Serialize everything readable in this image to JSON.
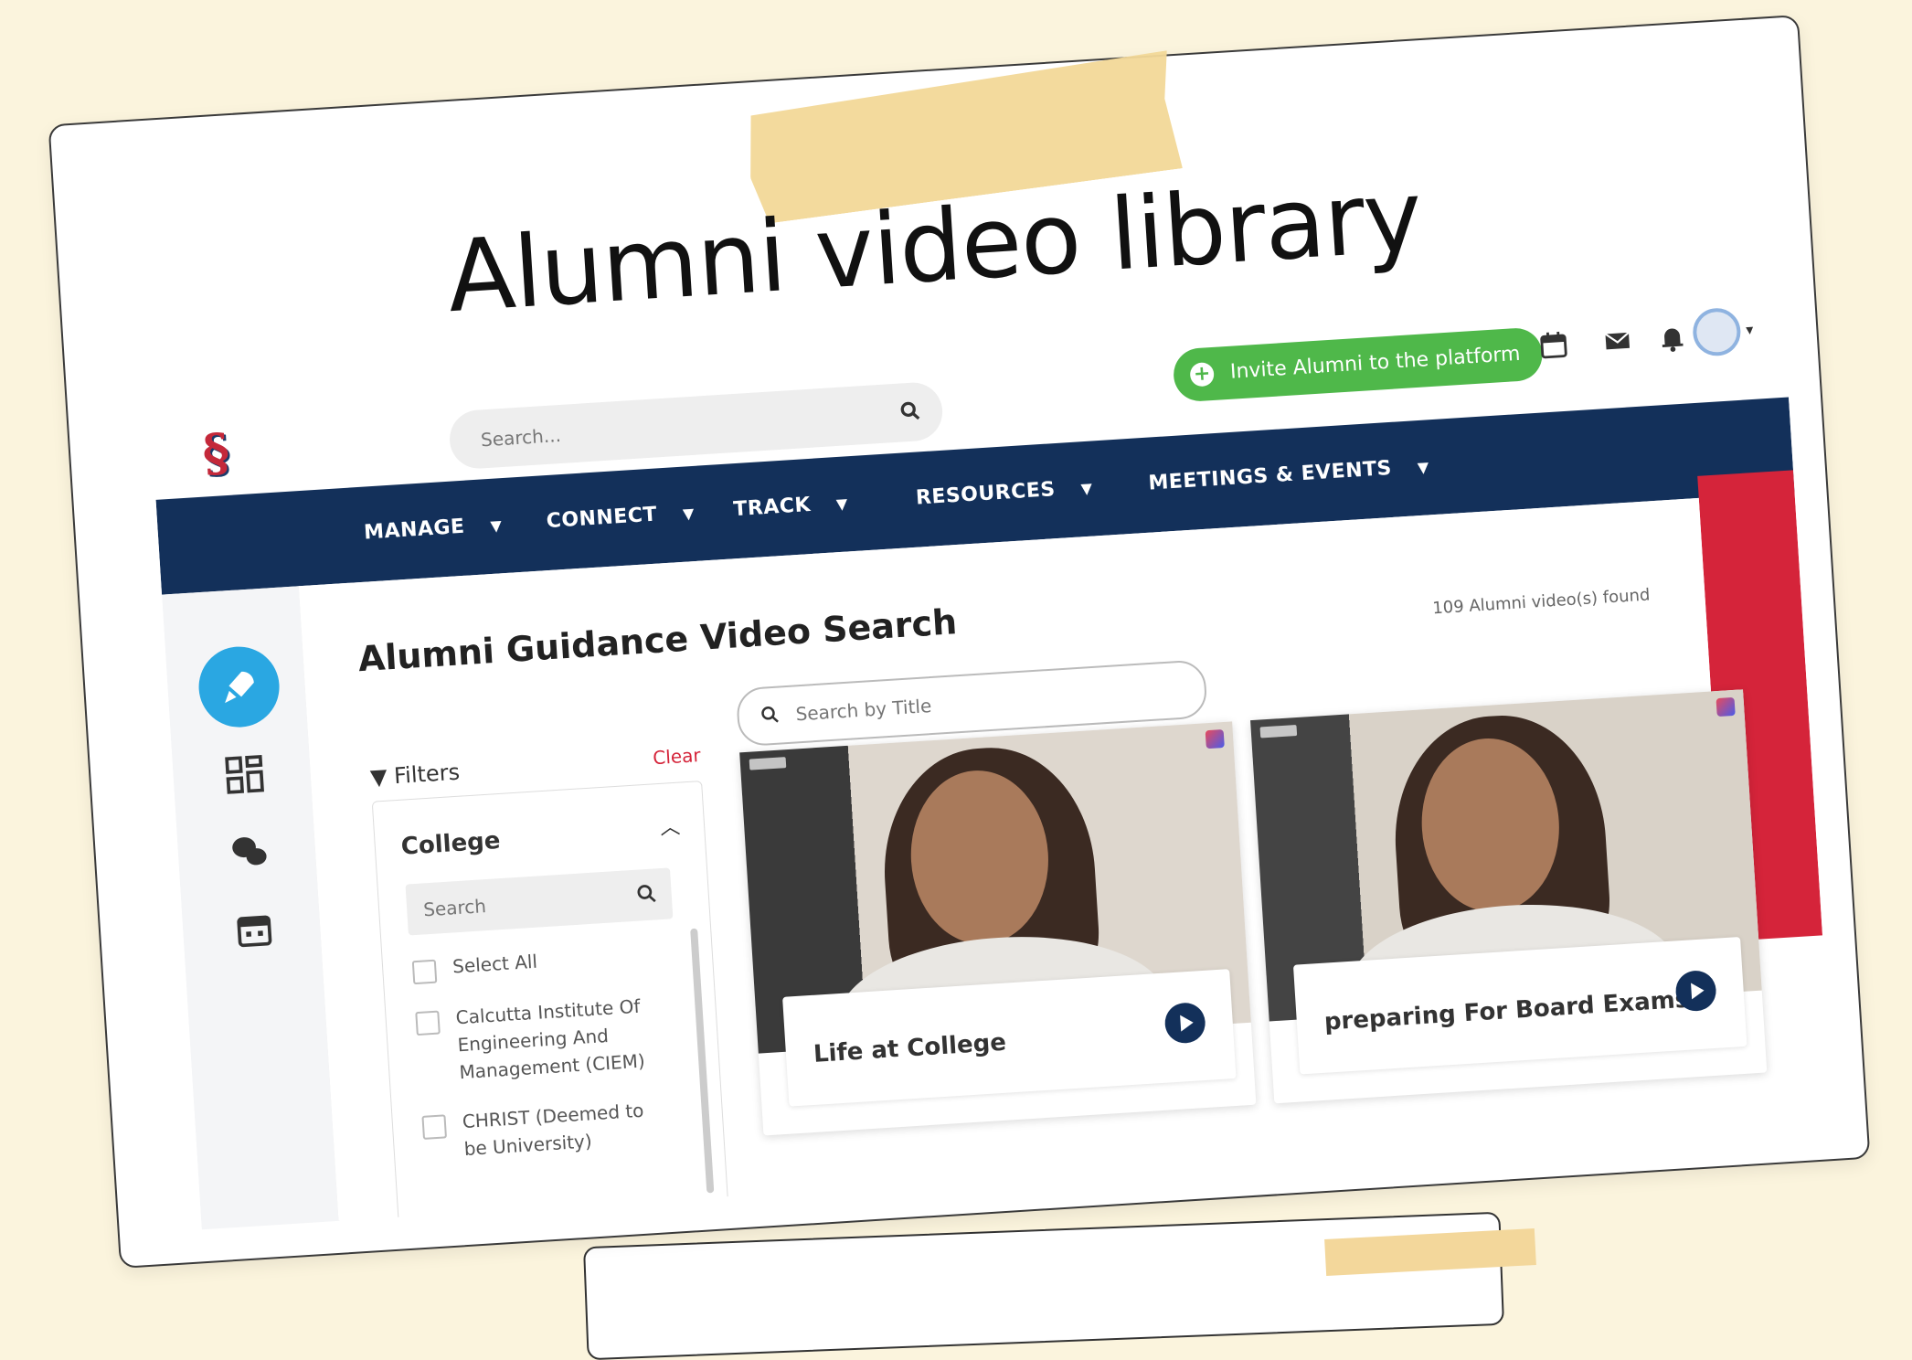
{
  "headline": "Alumni video library",
  "topbar": {
    "search_placeholder": "Search...",
    "invite_label": "Invite Alumni to the platform"
  },
  "nav": {
    "items": [
      {
        "label": "MANAGE"
      },
      {
        "label": "CONNECT"
      },
      {
        "label": "TRACK"
      },
      {
        "label": "RESOURCES"
      },
      {
        "label": "MEETINGS & EVENTS"
      }
    ]
  },
  "main": {
    "title": "Alumni Guidance Video Search",
    "found_text": "109 Alumni video(s) found",
    "title_search_placeholder": "Search by Title"
  },
  "filters": {
    "label": "Filters",
    "clear_label": "Clear",
    "college_label": "College",
    "search_placeholder": "Search",
    "options": [
      {
        "label": "Select All"
      },
      {
        "label": "Calcutta Institute Of Engineering And Management (CIEM)"
      },
      {
        "label": "CHRIST (Deemed to be University)"
      }
    ]
  },
  "videos": [
    {
      "title": "Life at College"
    },
    {
      "title": "preparing For Board Exams"
    }
  ],
  "colors": {
    "nav_bg": "#13305a",
    "accent_green": "#4fb84a",
    "accent_red": "#d5243a",
    "accent_blue": "#2aa7e2"
  }
}
